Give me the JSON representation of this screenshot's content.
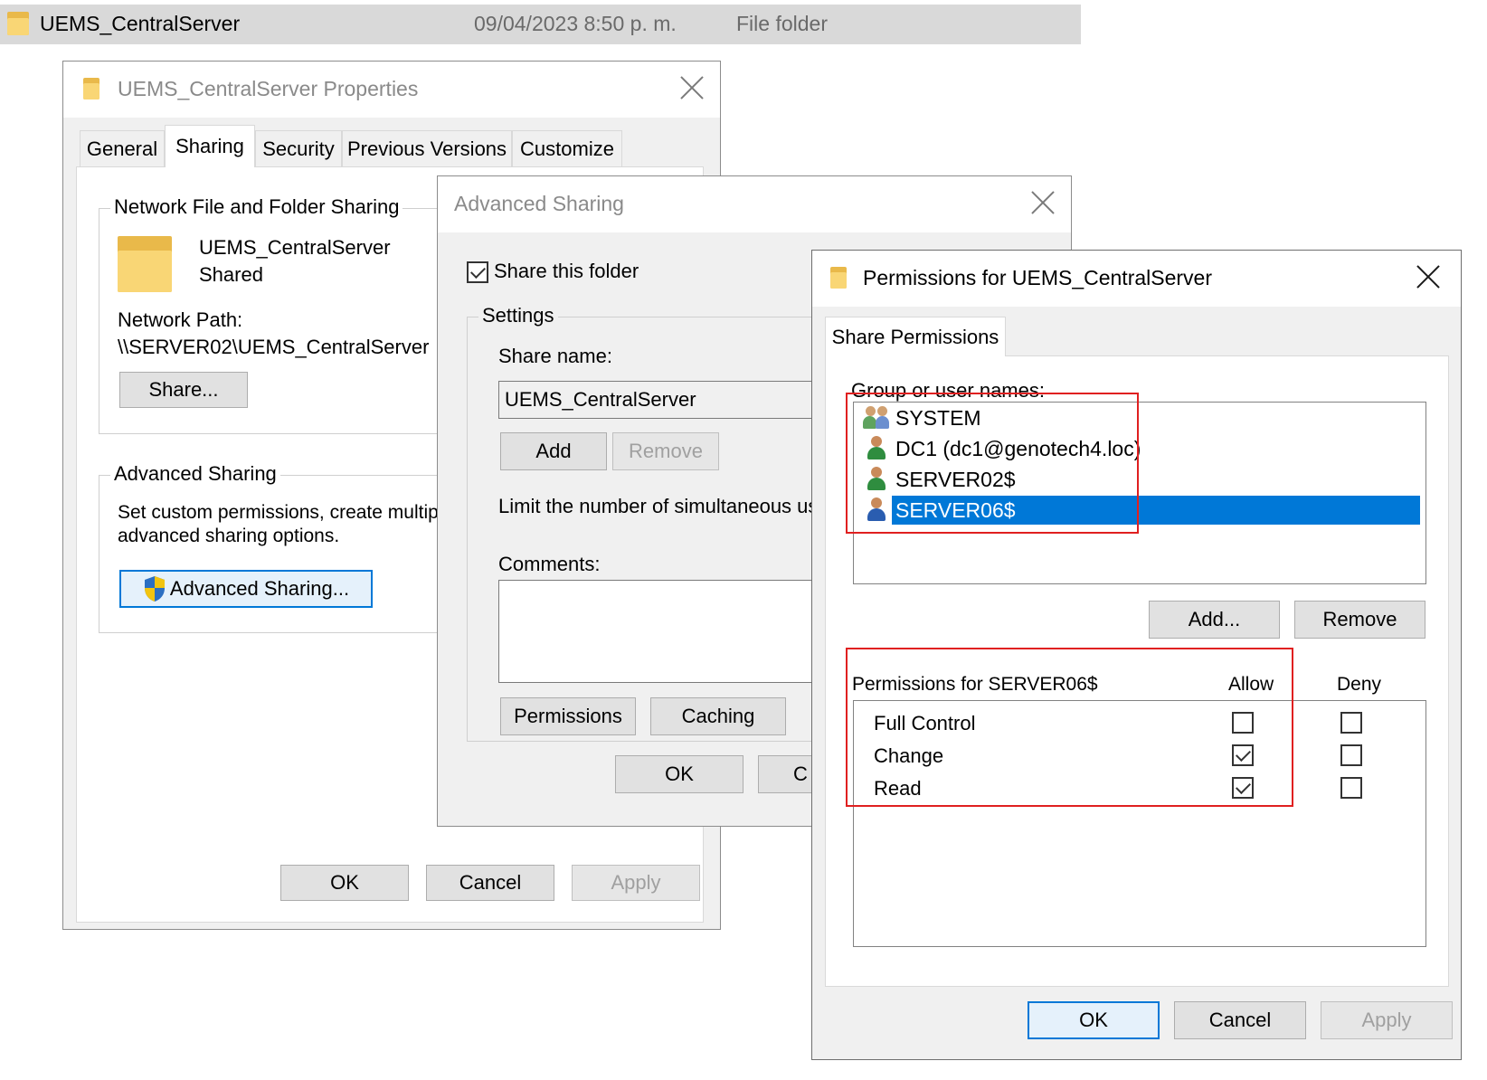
{
  "explorer_row": {
    "name": "UEMS_CentralServer",
    "date": "09/04/2023 8:50 p. m.",
    "type": "File folder"
  },
  "properties_dialog": {
    "title": "UEMS_CentralServer Properties",
    "tabs": [
      "General",
      "Sharing",
      "Security",
      "Previous Versions",
      "Customize"
    ],
    "selected_tab": "Sharing",
    "network_sharing": {
      "group_label": "Network File and Folder Sharing",
      "folder_name": "UEMS_CentralServer",
      "status": "Shared",
      "network_path_label": "Network Path:",
      "network_path": "\\\\SERVER02\\UEMS_CentralServer",
      "share_button": "Share..."
    },
    "advanced_sharing": {
      "group_label": "Advanced Sharing",
      "description_line1": "Set custom permissions, create multipl",
      "description_line2": "advanced sharing options.",
      "button": "Advanced Sharing..."
    },
    "buttons": {
      "ok": "OK",
      "cancel": "Cancel",
      "apply": "Apply"
    }
  },
  "advanced_sharing_dialog": {
    "title": "Advanced Sharing",
    "share_checkbox_label": "Share this folder",
    "share_checked": true,
    "settings_label": "Settings",
    "share_name_label": "Share name:",
    "share_name_value": "UEMS_CentralServer",
    "add_button": "Add",
    "remove_button": "Remove",
    "limit_label": "Limit the number of simultaneous use",
    "comments_label": "Comments:",
    "permissions_button": "Permissions",
    "caching_button": "Caching",
    "ok_button": "OK",
    "cancel_partial": "C"
  },
  "permissions_dialog": {
    "title": "Permissions for UEMS_CentralServer",
    "tab": "Share Permissions",
    "group_label": "Group or user names:",
    "users": [
      {
        "name": "SYSTEM",
        "icon": "group-icon",
        "selected": false
      },
      {
        "name": "DC1 (dc1@genotech4.loc)",
        "icon": "user-icon",
        "selected": false
      },
      {
        "name": "SERVER02$",
        "icon": "user-icon",
        "selected": false
      },
      {
        "name": "SERVER06$",
        "icon": "user-icon",
        "selected": true
      }
    ],
    "add_button": "Add...",
    "remove_button": "Remove",
    "permissions_for_label": "Permissions for SERVER06$",
    "allow_header": "Allow",
    "deny_header": "Deny",
    "permissions": [
      {
        "name": "Full Control",
        "allow": false,
        "deny": false
      },
      {
        "name": "Change",
        "allow": true,
        "deny": false
      },
      {
        "name": "Read",
        "allow": true,
        "deny": false
      }
    ],
    "ok_button": "OK",
    "cancel_button": "Cancel",
    "apply_button": "Apply"
  },
  "colors": {
    "selection": "#0078d7",
    "highlight_box": "#e02020",
    "folder": "#f9d675"
  }
}
